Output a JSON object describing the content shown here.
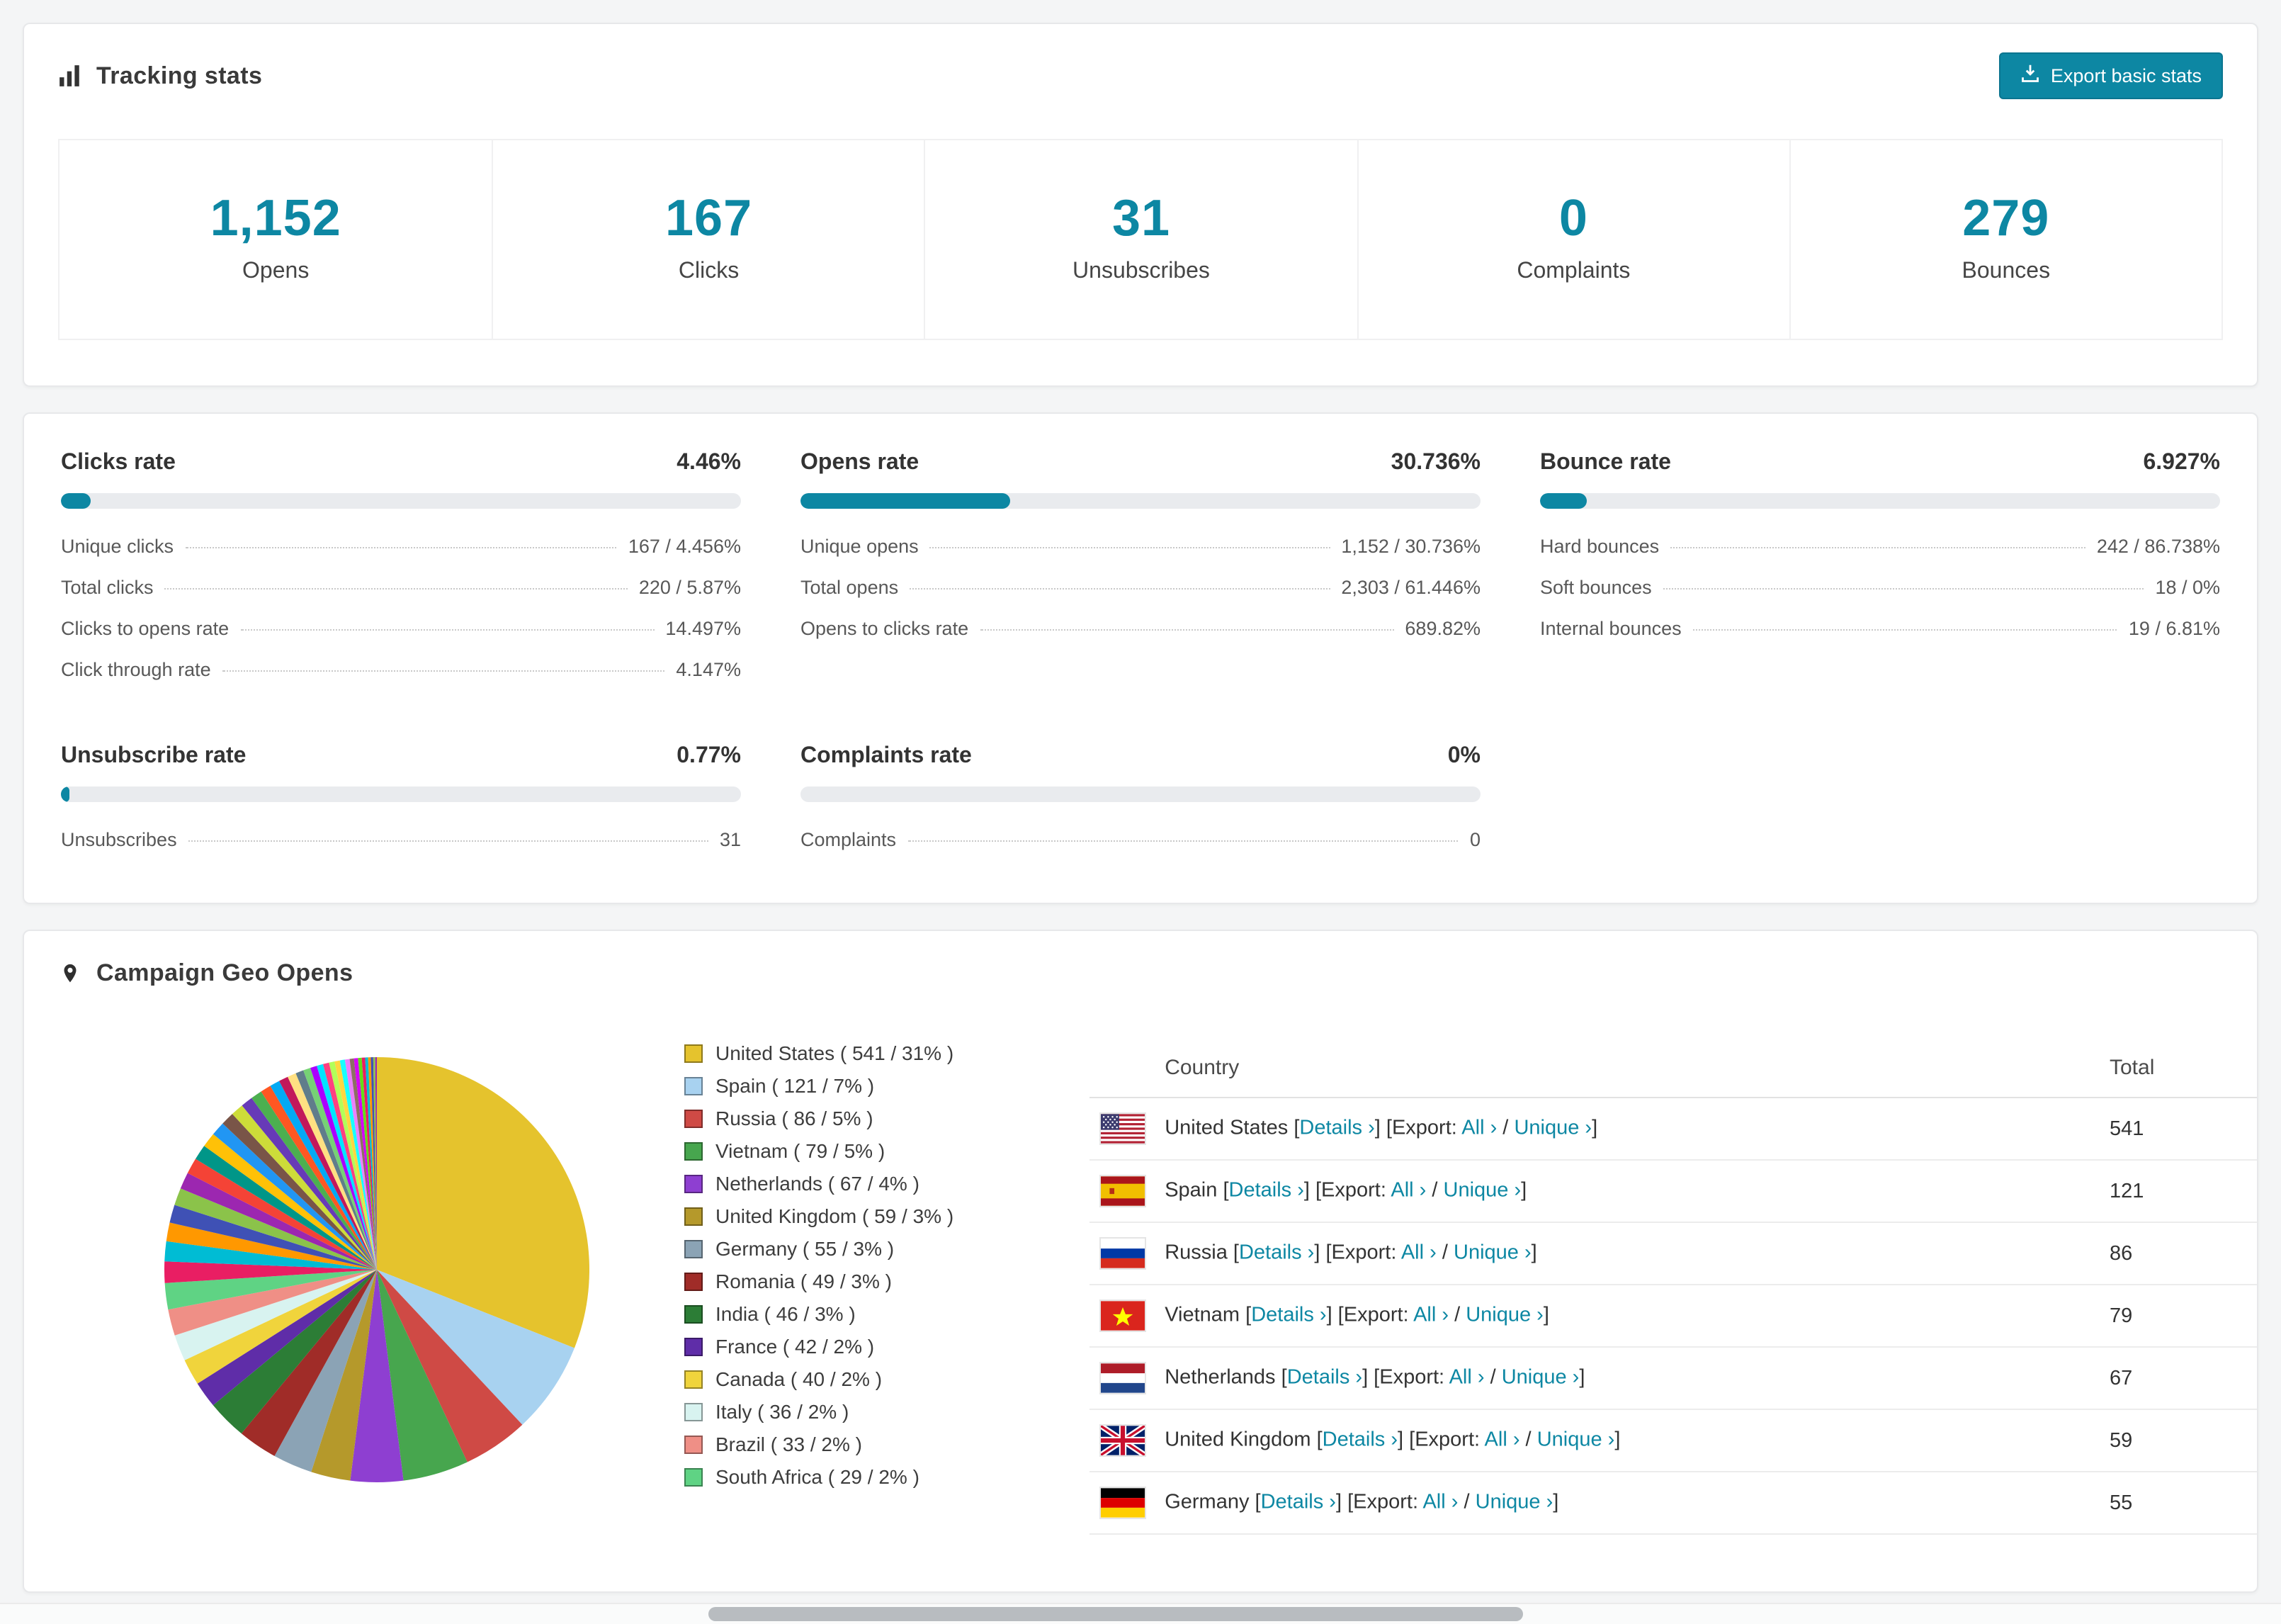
{
  "colors": {
    "accent": "#0d87a3",
    "bar_track": "#e9ebee",
    "link": "#0d87a3"
  },
  "tracking": {
    "title": "Tracking stats",
    "export_label": "Export basic stats",
    "stats": [
      {
        "value": "1,152",
        "label": "Opens"
      },
      {
        "value": "167",
        "label": "Clicks"
      },
      {
        "value": "31",
        "label": "Unsubscribes"
      },
      {
        "value": "0",
        "label": "Complaints"
      },
      {
        "value": "279",
        "label": "Bounces"
      }
    ]
  },
  "rates": {
    "blocks": [
      {
        "title": "Clicks rate",
        "percent_label": "4.46%",
        "percent_value": 4.46,
        "rows": [
          {
            "label": "Unique clicks",
            "value": "167 / 4.456%"
          },
          {
            "label": "Total clicks",
            "value": "220 / 5.87%"
          },
          {
            "label": "Clicks to opens rate",
            "value": "14.497%"
          },
          {
            "label": "Click through rate",
            "value": "4.147%"
          }
        ]
      },
      {
        "title": "Opens rate",
        "percent_label": "30.736%",
        "percent_value": 30.736,
        "rows": [
          {
            "label": "Unique opens",
            "value": "1,152 / 30.736%"
          },
          {
            "label": "Total opens",
            "value": "2,303 / 61.446%"
          },
          {
            "label": "Opens to clicks rate",
            "value": "689.82%"
          }
        ]
      },
      {
        "title": "Bounce rate",
        "percent_label": "6.927%",
        "percent_value": 6.927,
        "rows": [
          {
            "label": "Hard bounces",
            "value": "242 / 86.738%"
          },
          {
            "label": "Soft bounces",
            "value": "18 / 0%"
          },
          {
            "label": "Internal bounces",
            "value": "19 / 6.81%"
          }
        ]
      },
      {
        "title": "Unsubscribe rate",
        "percent_label": "0.77%",
        "percent_value": 0.77,
        "rows": [
          {
            "label": "Unsubscribes",
            "value": "31"
          }
        ]
      },
      {
        "title": "Complaints rate",
        "percent_label": "0%",
        "percent_value": 0,
        "rows": [
          {
            "label": "Complaints",
            "value": "0"
          }
        ]
      }
    ]
  },
  "geo": {
    "title": "Campaign Geo Opens",
    "table": {
      "country_header": "Country",
      "total_header": "Total",
      "details_label": "Details ›",
      "export_prefix": "[Export:",
      "all_label": "All ›",
      "unique_label": "Unique ›",
      "rows": [
        {
          "country": "United States",
          "flag": "us",
          "total": "541"
        },
        {
          "country": "Spain",
          "flag": "es",
          "total": "121"
        },
        {
          "country": "Russia",
          "flag": "ru",
          "total": "86"
        },
        {
          "country": "Vietnam",
          "flag": "vn",
          "total": "79"
        },
        {
          "country": "Netherlands",
          "flag": "nl",
          "total": "67"
        },
        {
          "country": "United Kingdom",
          "flag": "gb",
          "total": "59"
        },
        {
          "country": "Germany",
          "flag": "de",
          "total": "55"
        }
      ]
    }
  },
  "chart_data": {
    "type": "pie",
    "title": "Campaign Geo Opens",
    "unit": "opens",
    "legend_position": "right",
    "slices": [
      {
        "label": "United States",
        "count": 541,
        "percent": 31,
        "color": "#e5c32d"
      },
      {
        "label": "Spain",
        "count": 121,
        "percent": 7,
        "color": "#a8d2f0"
      },
      {
        "label": "Russia",
        "count": 86,
        "percent": 5,
        "color": "#cf4a45"
      },
      {
        "label": "Vietnam",
        "count": 79,
        "percent": 5,
        "color": "#47a64e"
      },
      {
        "label": "Netherlands",
        "count": 67,
        "percent": 4,
        "color": "#8e3fd1"
      },
      {
        "label": "United Kingdom",
        "count": 59,
        "percent": 3,
        "color": "#b5992b"
      },
      {
        "label": "Germany",
        "count": 55,
        "percent": 3,
        "color": "#8ba3b5"
      },
      {
        "label": "Romania",
        "count": 49,
        "percent": 3,
        "color": "#a02c28"
      },
      {
        "label": "India",
        "count": 46,
        "percent": 3,
        "color": "#2c7d36"
      },
      {
        "label": "France",
        "count": 42,
        "percent": 2,
        "color": "#5f2da8"
      },
      {
        "label": "Canada",
        "count": 40,
        "percent": 2,
        "color": "#f0d43c"
      },
      {
        "label": "Italy",
        "count": 36,
        "percent": 2,
        "color": "#d8f3f0"
      },
      {
        "label": "Brazil",
        "count": 33,
        "percent": 2,
        "color": "#ef8f86"
      },
      {
        "label": "South Africa",
        "count": 29,
        "percent": 2,
        "color": "#5fd384"
      }
    ],
    "other_slices_percent": 26,
    "other_slice_weights": [
      1.6,
      1.5,
      1.4,
      1.35,
      1.3,
      1.25,
      1.2,
      1.15,
      1.1,
      1.05,
      1.0,
      0.95,
      0.9,
      0.85,
      0.8,
      0.75,
      0.7,
      0.65,
      0.6,
      0.55,
      0.5,
      0.48,
      0.45,
      0.42,
      0.4,
      0.38,
      0.35,
      0.32,
      0.3,
      0.28,
      0.25,
      0.22,
      0.2,
      0.18,
      0.15,
      0.12
    ],
    "other_slice_colors": [
      "#e91e63",
      "#00bcd4",
      "#ff9800",
      "#3f51b5",
      "#8bc34a",
      "#9c27b0",
      "#f44336",
      "#009688",
      "#ffc107",
      "#2196f3",
      "#795548",
      "#cddc39",
      "#673ab7",
      "#4caf50",
      "#ff5722",
      "#03a9f4",
      "#c2185b",
      "#ffe082",
      "#607d8b",
      "#76d275",
      "#aa00ff",
      "#00e5ff",
      "#ff4081",
      "#b2ff59",
      "#ffd740",
      "#18ffff",
      "#ea80fc",
      "#8d6e63",
      "#d500f9",
      "#64dd17"
    ]
  }
}
